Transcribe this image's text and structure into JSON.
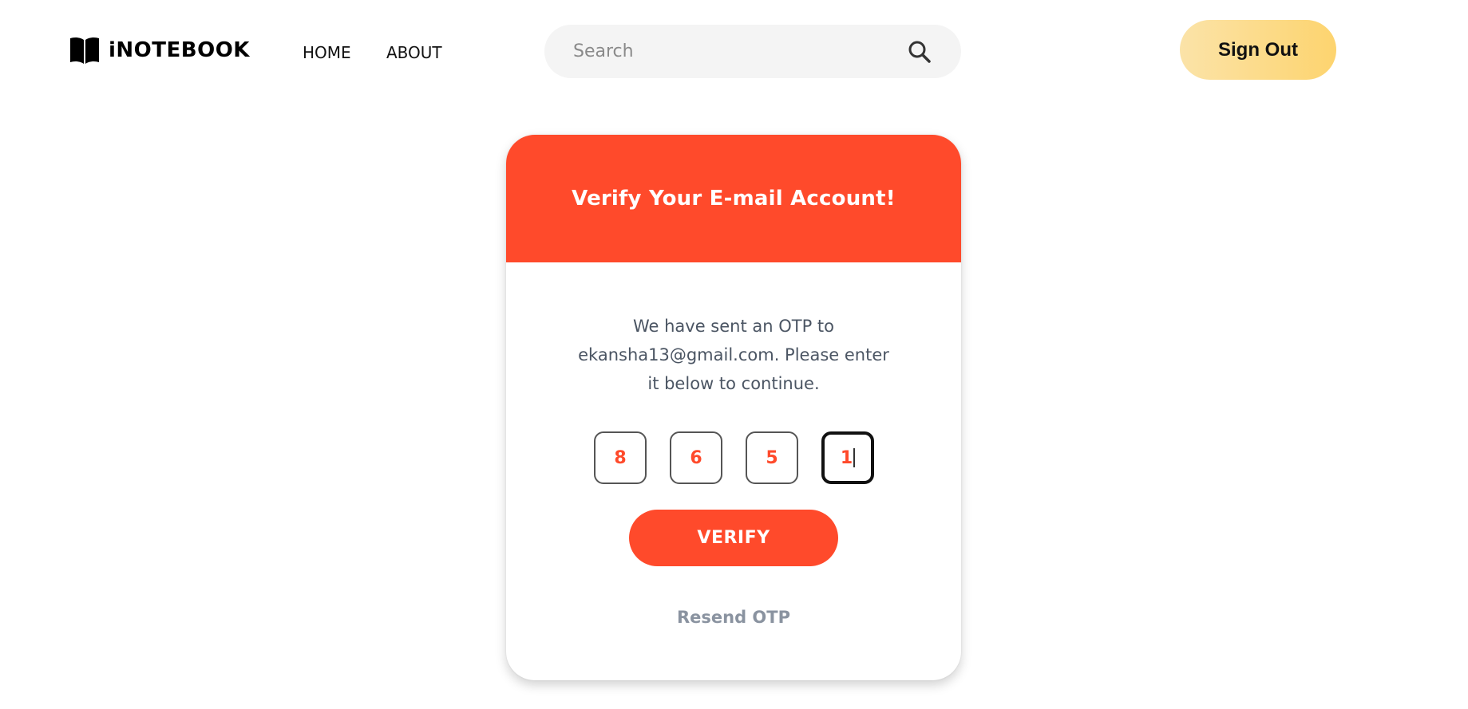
{
  "navbar": {
    "brand": "iNOTEBOOK",
    "brand_icon": "book-icon",
    "links": [
      {
        "label": "HOME"
      },
      {
        "label": "ABOUT"
      }
    ],
    "search": {
      "placeholder": "Search",
      "value": "",
      "icon": "search-icon"
    },
    "signout_label": "Sign Out"
  },
  "card": {
    "title": "Verify Your E-mail Account!",
    "message": "We have sent an OTP to ekansha13@gmail.com. Please enter it below to continue.",
    "otp_digits": [
      "8",
      "6",
      "5",
      "1"
    ],
    "active_digit_index": 3,
    "verify_label": "VERIFY",
    "resend_label": "Resend OTP"
  },
  "colors": {
    "accent": "#ff4a2b",
    "signout_gradient_start": "#fbe3a8",
    "signout_gradient_end": "#fdd46f",
    "muted_text": "#8a93a0"
  }
}
